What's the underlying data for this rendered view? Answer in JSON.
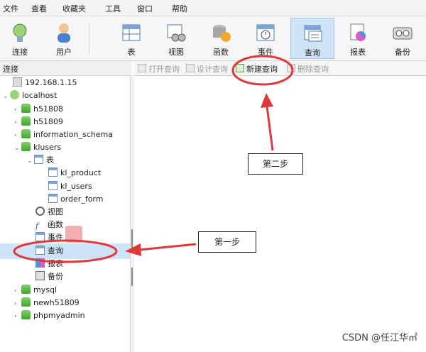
{
  "menu": [
    "文件",
    "查看",
    "收藏夹",
    "工具",
    "窗口",
    "帮助"
  ],
  "toolbar": [
    {
      "label": "连接",
      "icon": "connect-icon"
    },
    {
      "label": "用户",
      "icon": "user-icon"
    },
    {
      "label": "表",
      "icon": "table-icon"
    },
    {
      "label": "视图",
      "icon": "view-icon"
    },
    {
      "label": "函数",
      "icon": "function-icon"
    },
    {
      "label": "事件",
      "icon": "event-icon"
    },
    {
      "label": "查询",
      "icon": "query-icon",
      "active": true
    },
    {
      "label": "报表",
      "icon": "report-icon"
    },
    {
      "label": "备份",
      "icon": "backup-icon"
    }
  ],
  "panel": {
    "title": "连接"
  },
  "subtoolbar": [
    {
      "label": "打开查询",
      "enabled": false
    },
    {
      "label": "设计查询",
      "enabled": false
    },
    {
      "label": "新建查询",
      "enabled": true
    },
    {
      "label": "删除查询",
      "enabled": false
    }
  ],
  "tree": {
    "server": "192.168.1.15",
    "host": "localhost",
    "databases": [
      "h51808",
      "h51809",
      "information_schema",
      "klusers"
    ],
    "group_tables": "表",
    "tables": [
      "kl_product",
      "kl_users",
      "order_form"
    ],
    "objects": [
      "视图",
      "函数",
      "事件",
      "查询",
      "报表",
      "备份"
    ],
    "more_databases": [
      "mysql",
      "newh51809",
      "phpmyadmin"
    ]
  },
  "annotations": {
    "step1": "第一步",
    "step2": "第二步"
  },
  "watermark": "CSDN @任江华㎡",
  "colors": {
    "annotation": "#e0383a",
    "selection": "#cde4f8",
    "active_tool": "#cfe3f6"
  }
}
